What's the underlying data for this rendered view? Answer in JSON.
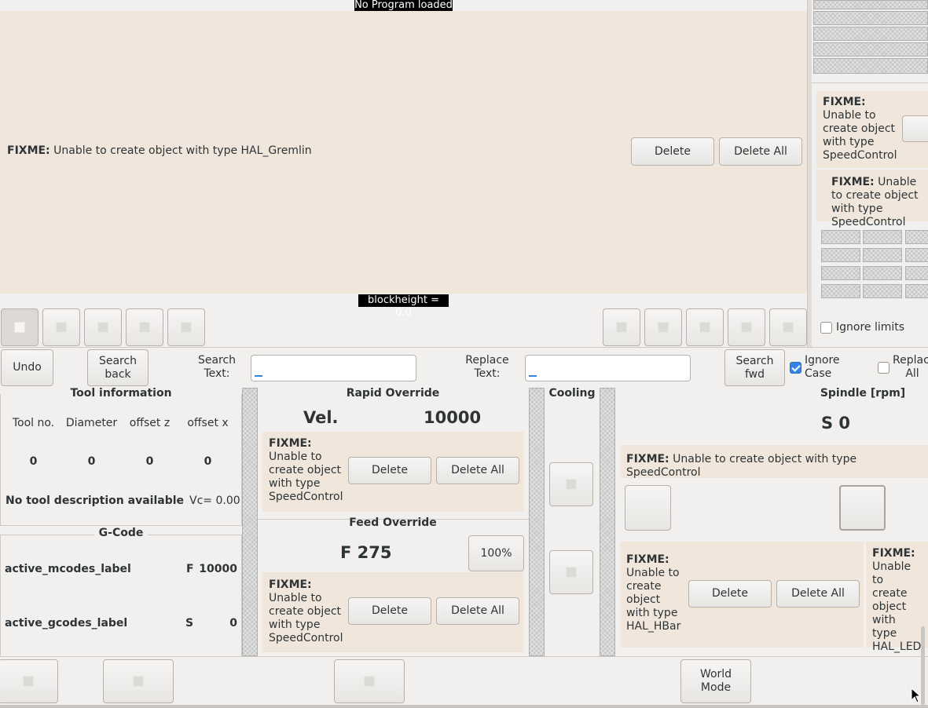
{
  "preview": {
    "banner": "No Program loaded",
    "fixme_bold": "FIXME:",
    "fixme_text": "Unable to create object with type HAL_Gremlin",
    "delete": "Delete",
    "delete_all": "Delete All",
    "blockheight": "blockheight = 0.0"
  },
  "right_panel": {
    "fixme1_bold": "FIXME:",
    "fixme1_text": "Unable to create object with type SpeedControl",
    "fixme2_bold": "FIXME:",
    "fixme2_text": "Unable to create object with type SpeedControl",
    "ignore_limits": "Ignore limits"
  },
  "search_bar": {
    "undo": "Undo",
    "search_back": "Search back",
    "search_text_label": "Search Text:",
    "search_text_value": "",
    "replace_text_label": "Replace Text:",
    "replace_text_value": "",
    "search_fwd": "Search fwd",
    "ignore_case": "Ignore Case",
    "replace_all": "Replace All"
  },
  "tool_info": {
    "title": "Tool information",
    "headers": [
      "Tool no.",
      "Diameter",
      "offset z",
      "offset x"
    ],
    "values": [
      "0",
      "0",
      "0",
      "0"
    ],
    "description": "No tool description available",
    "vc": "Vc= 0.00"
  },
  "gcode": {
    "title": "G-Code",
    "mcodes": "active_mcodes_label",
    "gcodes": "active_gcodes_label",
    "f_label": "F",
    "f_value": "10000",
    "s_label": "S",
    "s_value": "0"
  },
  "rapid_override": {
    "title": "Rapid Override",
    "vel_label": "Vel.",
    "vel_value": "10000",
    "fixme_bold": "FIXME:",
    "fixme_text": "Unable to create object with type SpeedControl",
    "delete": "Delete",
    "delete_all": "Delete All"
  },
  "feed_override": {
    "title": "Feed Override",
    "value": "F 275",
    "percent_button": "100%",
    "fixme_bold": "FIXME:",
    "fixme_text": "Unable to create object with type SpeedControl",
    "delete": "Delete",
    "delete_all": "Delete All"
  },
  "cooling": {
    "title": "Cooling"
  },
  "spindle": {
    "title": "Spindle [rpm]",
    "value": "S 0",
    "fixme_bold": "FIXME:",
    "fixme_text": "Unable to create object with type SpeedControl",
    "hbar_fixme_bold": "FIXME:",
    "hbar_fixme_text": "Unable to create object with type HAL_HBar",
    "delete": "Delete",
    "delete_all": "Delete All",
    "led_fixme_bold": "FIXME:",
    "led_fixme_text": "Unable to create object with type HAL_LED"
  },
  "bottom_bar": {
    "world_mode": "World Mode"
  }
}
